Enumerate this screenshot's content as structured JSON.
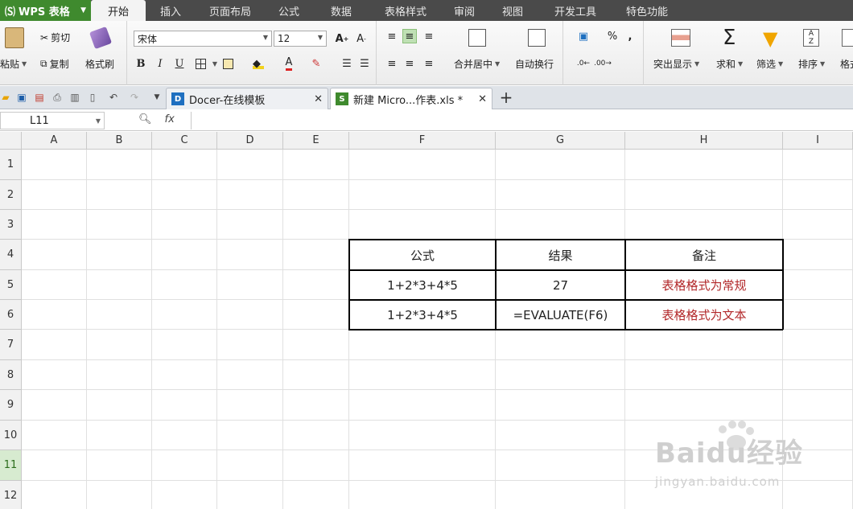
{
  "app": {
    "name": "WPS 表格"
  },
  "menu": {
    "tabs": [
      "开始",
      "插入",
      "页面布局",
      "公式",
      "数据",
      "表格样式",
      "审阅",
      "视图",
      "开发工具",
      "特色功能"
    ],
    "active": "开始"
  },
  "ribbon": {
    "clipboard": {
      "paste": "粘贴",
      "cut": "剪切",
      "copy": "复制",
      "format_painter": "格式刷"
    },
    "font": {
      "name": "宋体",
      "size": "12",
      "bold": "B",
      "italic": "I",
      "underline": "U",
      "font_color_letter": "A",
      "grow": "A",
      "shrink": "A"
    },
    "align": {
      "merge_center": "合并居中",
      "wrap": "自动换行"
    },
    "number": {
      "percent": "%",
      "comma": ","
    },
    "editing": {
      "highlight": "突出显示",
      "sum": "求和",
      "filter": "筛选",
      "sort": "排序",
      "format_partial": "格式"
    }
  },
  "doc_tabs": [
    {
      "title": "Docer-在线模板",
      "icon_letter": "D",
      "active": false
    },
    {
      "title": "新建 Micro...作表.xls *",
      "icon_letter": "S",
      "active": true
    }
  ],
  "new_tab_symbol": "+",
  "formula_bar": {
    "name_box": "L11",
    "fx": "fx",
    "formula": ""
  },
  "columns": [
    "A",
    "B",
    "C",
    "D",
    "E",
    "F",
    "G",
    "H",
    "I"
  ],
  "rows": [
    "1",
    "2",
    "3",
    "4",
    "5",
    "6",
    "7",
    "8",
    "9",
    "10",
    "11",
    "12"
  ],
  "selected_row": "11",
  "table": {
    "headers": [
      "公式",
      "结果",
      "备注"
    ],
    "rows": [
      [
        "1+2*3+4*5",
        "27",
        "表格格式为常规"
      ],
      [
        "1+2*3+4*5",
        "=EVALUATE(F6)",
        "表格格式为文本"
      ]
    ]
  },
  "colors": {
    "accent_green": "#3f8a2e",
    "note_red": "#b2282a",
    "menubar": "#4a4a4a"
  },
  "watermark": {
    "brand": "Baidu经验",
    "url": "jingyan.baidu.com"
  }
}
